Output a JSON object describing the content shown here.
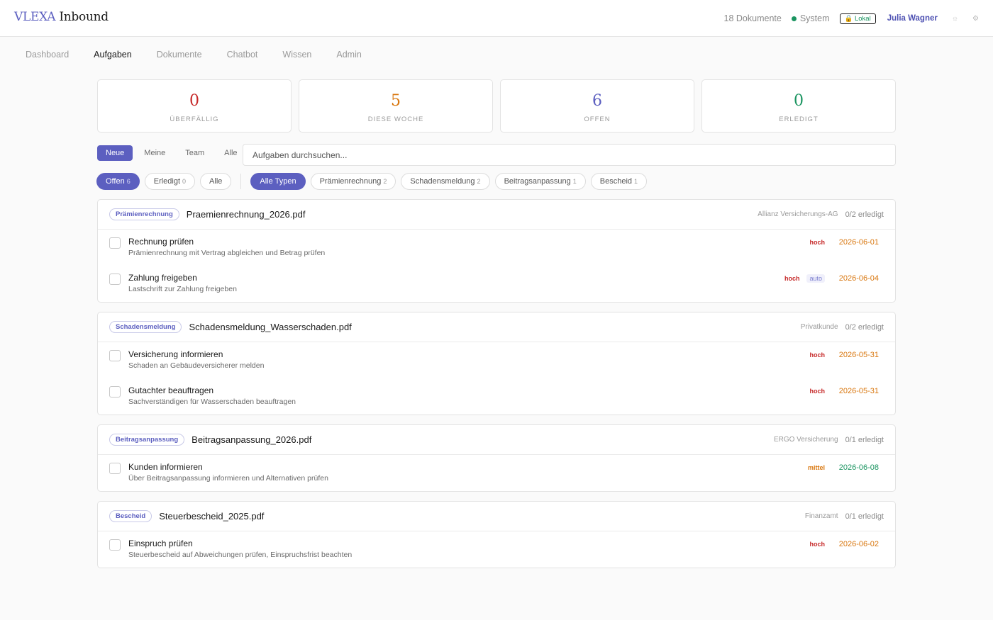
{
  "header": {
    "brand_part1": "VLEXA",
    "brand_part2": "Inbound",
    "doc_count": "18 Dokumente",
    "system_label": "System",
    "local_badge": "🔒 Lokal",
    "user_name": "Julia Wagner",
    "theme_icon": "☼",
    "settings_icon": "⚙"
  },
  "nav": {
    "items": [
      "Dashboard",
      "Aufgaben",
      "Dokumente",
      "Chatbot",
      "Wissen",
      "Admin"
    ],
    "active": "Aufgaben"
  },
  "stats": [
    {
      "value": "0",
      "label": "ÜBERFÄLLIG",
      "color": "#c62828"
    },
    {
      "value": "5",
      "label": "DIESE WOCHE",
      "color": "#d9770f"
    },
    {
      "value": "6",
      "label": "OFFEN",
      "color": "#5c5fc0"
    },
    {
      "value": "0",
      "label": "ERLEDIGT",
      "color": "#1a9460"
    }
  ],
  "scope_tabs": [
    "Neue",
    "Meine",
    "Team",
    "Alle"
  ],
  "search": {
    "placeholder": "Aufgaben durchsuchen..."
  },
  "status_filters": [
    {
      "label": "Offen",
      "count": "6"
    },
    {
      "label": "Erledigt",
      "count": "0"
    },
    {
      "label": "Alle",
      "count": ""
    }
  ],
  "type_filters": [
    {
      "label": "Alle Typen",
      "count": ""
    },
    {
      "label": "Prämienrechnung",
      "count": "2"
    },
    {
      "label": "Schadensmeldung",
      "count": "2"
    },
    {
      "label": "Beitragsanpassung",
      "count": "1"
    },
    {
      "label": "Bescheid",
      "count": "1"
    }
  ],
  "groups": [
    {
      "type": "Prämienrechnung",
      "file": "Praemienrechnung_2026.pdf",
      "sender": "Allianz Versicherungs-AG",
      "progress": "0/2 erledigt",
      "tasks": [
        {
          "title": "Rechnung prüfen",
          "desc": "Prämienrechnung mit Vertrag abgleichen und Betrag prüfen",
          "priority": "hoch",
          "auto": "",
          "due": "2026-06-01",
          "due_color": "#d9770f"
        },
        {
          "title": "Zahlung freigeben",
          "desc": "Lastschrift zur Zahlung freigeben",
          "priority": "hoch",
          "auto": "auto",
          "due": "2026-06-04",
          "due_color": "#d9770f"
        }
      ]
    },
    {
      "type": "Schadensmeldung",
      "file": "Schadensmeldung_Wasserschaden.pdf",
      "sender": "Privatkunde",
      "progress": "0/2 erledigt",
      "tasks": [
        {
          "title": "Versicherung informieren",
          "desc": "Schaden an Gebäudeversicherer melden",
          "priority": "hoch",
          "auto": "",
          "due": "2026-05-31",
          "due_color": "#d9770f"
        },
        {
          "title": "Gutachter beauftragen",
          "desc": "Sachverständigen für Wasserschaden beauftragen",
          "priority": "hoch",
          "auto": "",
          "due": "2026-05-31",
          "due_color": "#d9770f"
        }
      ]
    },
    {
      "type": "Beitragsanpassung",
      "file": "Beitragsanpassung_2026.pdf",
      "sender": "ERGO Versicherung",
      "progress": "0/1 erledigt",
      "tasks": [
        {
          "title": "Kunden informieren",
          "desc": "Über Beitragsanpassung informieren und Alternativen prüfen",
          "priority": "mittel",
          "auto": "",
          "due": "2026-06-08",
          "due_color": "#1a9460"
        }
      ]
    },
    {
      "type": "Bescheid",
      "file": "Steuerbescheid_2025.pdf",
      "sender": "Finanzamt",
      "progress": "0/1 erledigt",
      "tasks": [
        {
          "title": "Einspruch prüfen",
          "desc": "Steuerbescheid auf Abweichungen prüfen, Einspruchsfrist beachten",
          "priority": "hoch",
          "auto": "",
          "due": "2026-06-02",
          "due_color": "#d9770f"
        }
      ]
    }
  ]
}
